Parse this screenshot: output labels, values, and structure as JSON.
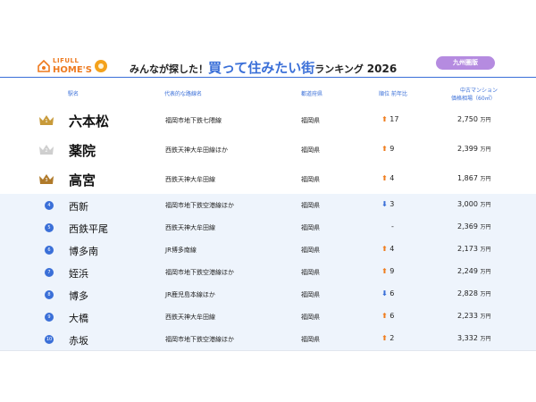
{
  "header": {
    "logo_line1": "LIFULL",
    "logo_line2": "HOME'S",
    "title_pre": "みんなが探した！",
    "title_big": "買って住みたい街",
    "title_post": "ランキング",
    "title_year": "2026",
    "region": "九州圏版",
    "accent_color": "#3a6fd8",
    "logo_color": "#ee7a1f",
    "region_color": "#b58be0"
  },
  "columns": {
    "station": "駅名",
    "line": "代表的な路線名",
    "prefecture": "都道府県",
    "rank_change_1": "順位",
    "rank_change_2": "前年比",
    "price_1": "中古マンション",
    "price_2": "価格相場（60㎡）"
  },
  "rows": [
    {
      "rank": "1",
      "station": "六本松",
      "line": "福岡市地下鉄七隈線",
      "pref": "福岡県",
      "dir": "up",
      "change": "17",
      "price": "2,750",
      "unit": "万円"
    },
    {
      "rank": "2",
      "station": "薬院",
      "line": "西鉄天神大牟田線ほか",
      "pref": "福岡県",
      "dir": "up",
      "change": "9",
      "price": "2,399",
      "unit": "万円"
    },
    {
      "rank": "3",
      "station": "高宮",
      "line": "西鉄天神大牟田線",
      "pref": "福岡県",
      "dir": "up",
      "change": "4",
      "price": "1,867",
      "unit": "万円"
    },
    {
      "rank": "4",
      "station": "西新",
      "line": "福岡市地下鉄空港線ほか",
      "pref": "福岡県",
      "dir": "down",
      "change": "3",
      "price": "3,000",
      "unit": "万円"
    },
    {
      "rank": "5",
      "station": "西鉄平尾",
      "line": "西鉄天神大牟田線",
      "pref": "福岡県",
      "dir": "none",
      "change": "-",
      "price": "2,369",
      "unit": "万円"
    },
    {
      "rank": "6",
      "station": "博多南",
      "line": "JR博多南線",
      "pref": "福岡県",
      "dir": "up",
      "change": "4",
      "price": "2,173",
      "unit": "万円"
    },
    {
      "rank": "7",
      "station": "姪浜",
      "line": "福岡市地下鉄空港線ほか",
      "pref": "福岡県",
      "dir": "up",
      "change": "9",
      "price": "2,249",
      "unit": "万円"
    },
    {
      "rank": "8",
      "station": "博多",
      "line": "JR鹿児島本線ほか",
      "pref": "福岡県",
      "dir": "down",
      "change": "6",
      "price": "2,828",
      "unit": "万円"
    },
    {
      "rank": "9",
      "station": "大橋",
      "line": "西鉄天神大牟田線",
      "pref": "福岡県",
      "dir": "up",
      "change": "6",
      "price": "2,233",
      "unit": "万円"
    },
    {
      "rank": "10",
      "station": "赤坂",
      "line": "福岡市地下鉄空港線ほか",
      "pref": "福岡県",
      "dir": "up",
      "change": "2",
      "price": "3,332",
      "unit": "万円"
    }
  ],
  "crown_colors": [
    "#c89a3a",
    "#cfcfcf",
    "#b07a2a"
  ],
  "arrow_up_color": "#ef7d1e",
  "arrow_down_color": "#3a6fd8"
}
